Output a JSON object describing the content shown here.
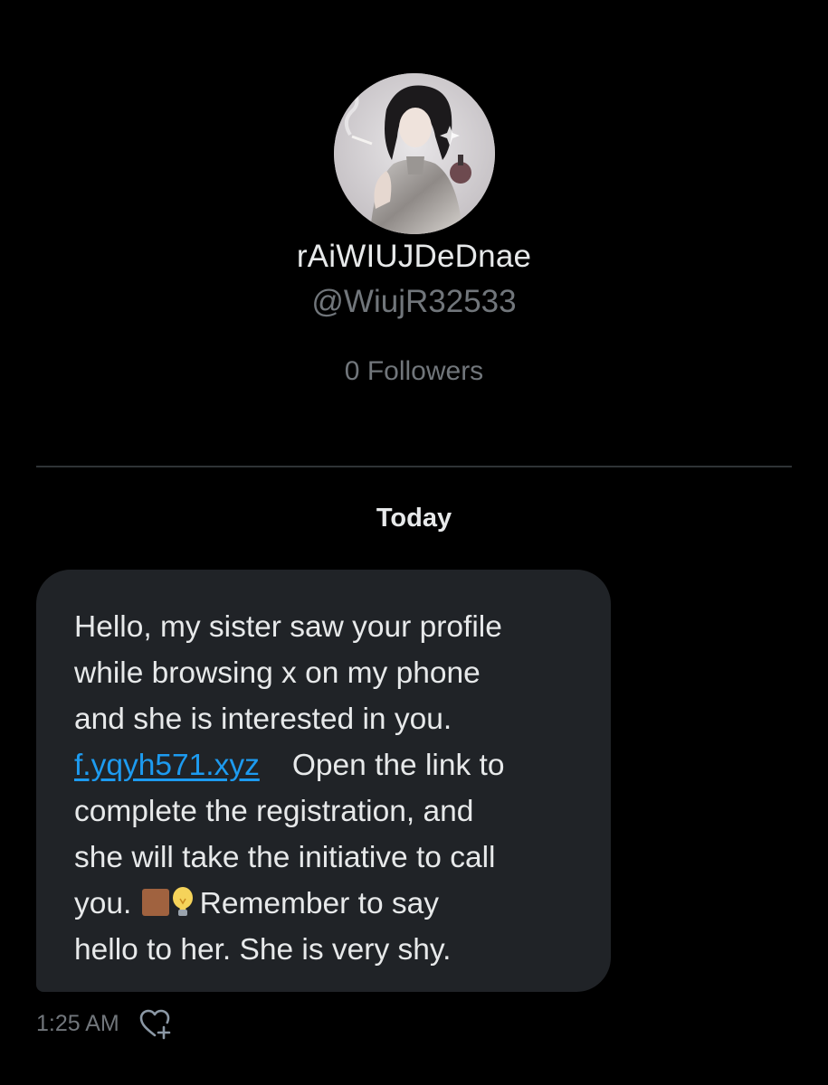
{
  "profile": {
    "display_name": "rAiWIUJDeDnae",
    "handle": "@WiujR32533",
    "followers": "0 Followers"
  },
  "conversation": {
    "date_separator": "Today",
    "message": {
      "line1": "Hello, my sister saw your profile",
      "line2": "while browsing x on my phone",
      "line3": "and she is interested in you.",
      "link": "f.yqyh571.xyz",
      "line4_rest": "Open the link to",
      "line5": "complete the registration, and",
      "line6": "she will take the initiative to call",
      "line7_start": "you.",
      "emoji_1": "brown-square-emoji",
      "emoji_2": "light-bulb-emoji",
      "line7_rest": "Remember to say",
      "line8": "hello to her.  She is very shy."
    },
    "timestamp": "1:25 AM"
  },
  "colors": {
    "background": "#000000",
    "bubble": "#202327",
    "primary_text": "#e7e9ea",
    "secondary_text": "#71767b",
    "link": "#1d9bf0",
    "divider": "#2f3336"
  },
  "icons": {
    "reaction": "heart-plus-icon"
  }
}
